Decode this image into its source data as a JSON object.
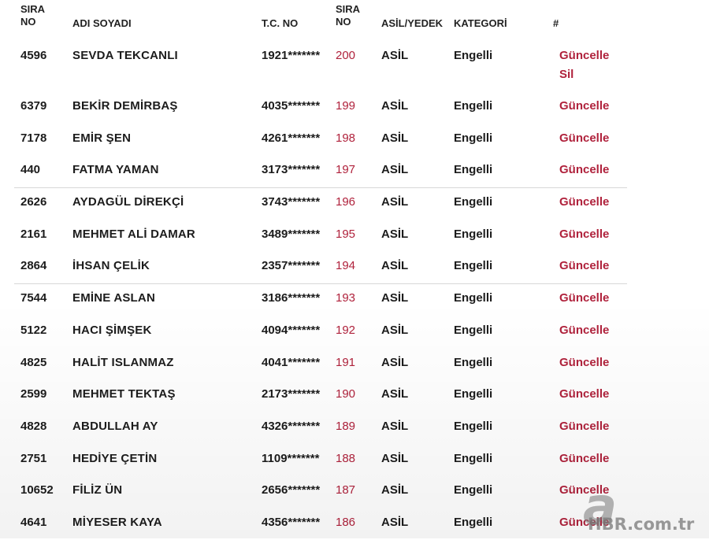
{
  "header": {
    "sira": "SIRA NO",
    "sira_l1": "SIRA",
    "sira_l2": "NO",
    "name": "ADI SOYADI",
    "tc": "T.C. NO",
    "sira2_l1": "SIRA",
    "sira2_l2": "NO",
    "asil": "ASİL/YEDEK",
    "kategori": "KATEGORİ",
    "hash": "#"
  },
  "rows": [
    {
      "sira": "4596",
      "name": "SEVDA TEKCANLI",
      "tc": "1921*******",
      "no": "200",
      "asil": "ASİL",
      "kategori": "Engelli",
      "action": "Güncelle",
      "action2": "Sil"
    },
    {
      "sira": "6379",
      "name": "BEKİR DEMİRBAŞ",
      "tc": "4035*******",
      "no": "199",
      "asil": "ASİL",
      "kategori": "Engelli",
      "action": "Güncelle"
    },
    {
      "sira": "7178",
      "name": "EMİR ŞEN",
      "tc": "4261*******",
      "no": "198",
      "asil": "ASİL",
      "kategori": "Engelli",
      "action": "Güncelle"
    },
    {
      "sira": "440",
      "name": "FATMA YAMAN",
      "tc": "3173*******",
      "no": "197",
      "asil": "ASİL",
      "kategori": "Engelli",
      "action": "Güncelle"
    },
    {
      "sira": "2626",
      "name": "AYDAGÜL DİREKÇİ",
      "tc": "3743*******",
      "no": "196",
      "asil": "ASİL",
      "kategori": "Engelli",
      "action": "Güncelle"
    },
    {
      "sira": "2161",
      "name": "MEHMET ALİ DAMAR",
      "tc": "3489*******",
      "no": "195",
      "asil": "ASİL",
      "kategori": "Engelli",
      "action": "Güncelle"
    },
    {
      "sira": "2864",
      "name": "İHSAN ÇELİK",
      "tc": "2357*******",
      "no": "194",
      "asil": "ASİL",
      "kategori": "Engelli",
      "action": "Güncelle"
    },
    {
      "sira": "7544",
      "name": "EMİNE ASLAN",
      "tc": "3186*******",
      "no": "193",
      "asil": "ASİL",
      "kategori": "Engelli",
      "action": "Güncelle"
    },
    {
      "sira": "5122",
      "name": "HACI ŞİMŞEK",
      "tc": "4094*******",
      "no": "192",
      "asil": "ASİL",
      "kategori": "Engelli",
      "action": "Güncelle"
    },
    {
      "sira": "4825",
      "name": "HALİT ISLANMAZ",
      "tc": "4041*******",
      "no": "191",
      "asil": "ASİL",
      "kategori": "Engelli",
      "action": "Güncelle"
    },
    {
      "sira": "2599",
      "name": "MEHMET TEKTAŞ",
      "tc": "2173*******",
      "no": "190",
      "asil": "ASİL",
      "kategori": "Engelli",
      "action": "Güncelle"
    },
    {
      "sira": "4828",
      "name": "ABDULLAH AY",
      "tc": "4326*******",
      "no": "189",
      "asil": "ASİL",
      "kategori": "Engelli",
      "action": "Güncelle"
    },
    {
      "sira": "2751",
      "name": "HEDİYE ÇETİN",
      "tc": "1109*******",
      "no": "188",
      "asil": "ASİL",
      "kategori": "Engelli",
      "action": "Güncelle"
    },
    {
      "sira": "10652",
      "name": "FİLİZ ÜN",
      "tc": "2656*******",
      "no": "187",
      "asil": "ASİL",
      "kategori": "Engelli",
      "action": "Güncelle"
    },
    {
      "sira": "4641",
      "name": "MİYESER KAYA",
      "tc": "4356*******",
      "no": "186",
      "asil": "ASİL",
      "kategori": "Engelli",
      "action": "Güncelle"
    }
  ],
  "watermark": {
    "logo": "a",
    "text": "HBR.com.tr"
  },
  "colors": {
    "link": "#b0223c",
    "text": "#1c1c1c",
    "divider": "#d8d8d8"
  }
}
